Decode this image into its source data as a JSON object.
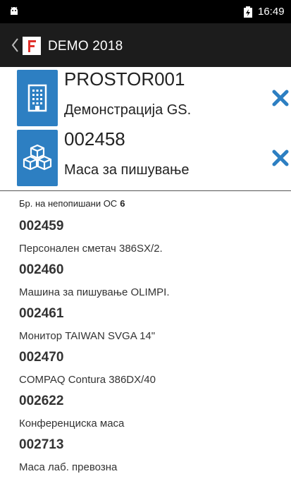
{
  "status_bar": {
    "time": "16:49"
  },
  "app_bar": {
    "logo_letter": "F",
    "title": "DEMO 2018"
  },
  "header": [
    {
      "code": "PROSTOR001",
      "name": "Демонстрација GS.",
      "icon": "building-icon"
    },
    {
      "code": "002458",
      "name": "Маса за пишување",
      "icon": "boxes-icon"
    }
  ],
  "count": {
    "label": "Бр. на непопишани ОС",
    "value": "6"
  },
  "items": [
    {
      "code": "002459",
      "desc": "Персонален сметач 386SX/2."
    },
    {
      "code": "002460",
      "desc": "Машина за пишување OLIMPI."
    },
    {
      "code": "002461",
      "desc": "Монитор TAIWAN SVGA 14\""
    },
    {
      "code": "002470",
      "desc": "COMPAQ Contura 386DX/40"
    },
    {
      "code": "002622",
      "desc": "Конференциска маса"
    },
    {
      "code": "002713",
      "desc": "Маса лаб. превозна"
    }
  ],
  "colors": {
    "accent": "#2d7fc2",
    "app_bar": "#1c1c1c",
    "status_bar": "#000000"
  }
}
